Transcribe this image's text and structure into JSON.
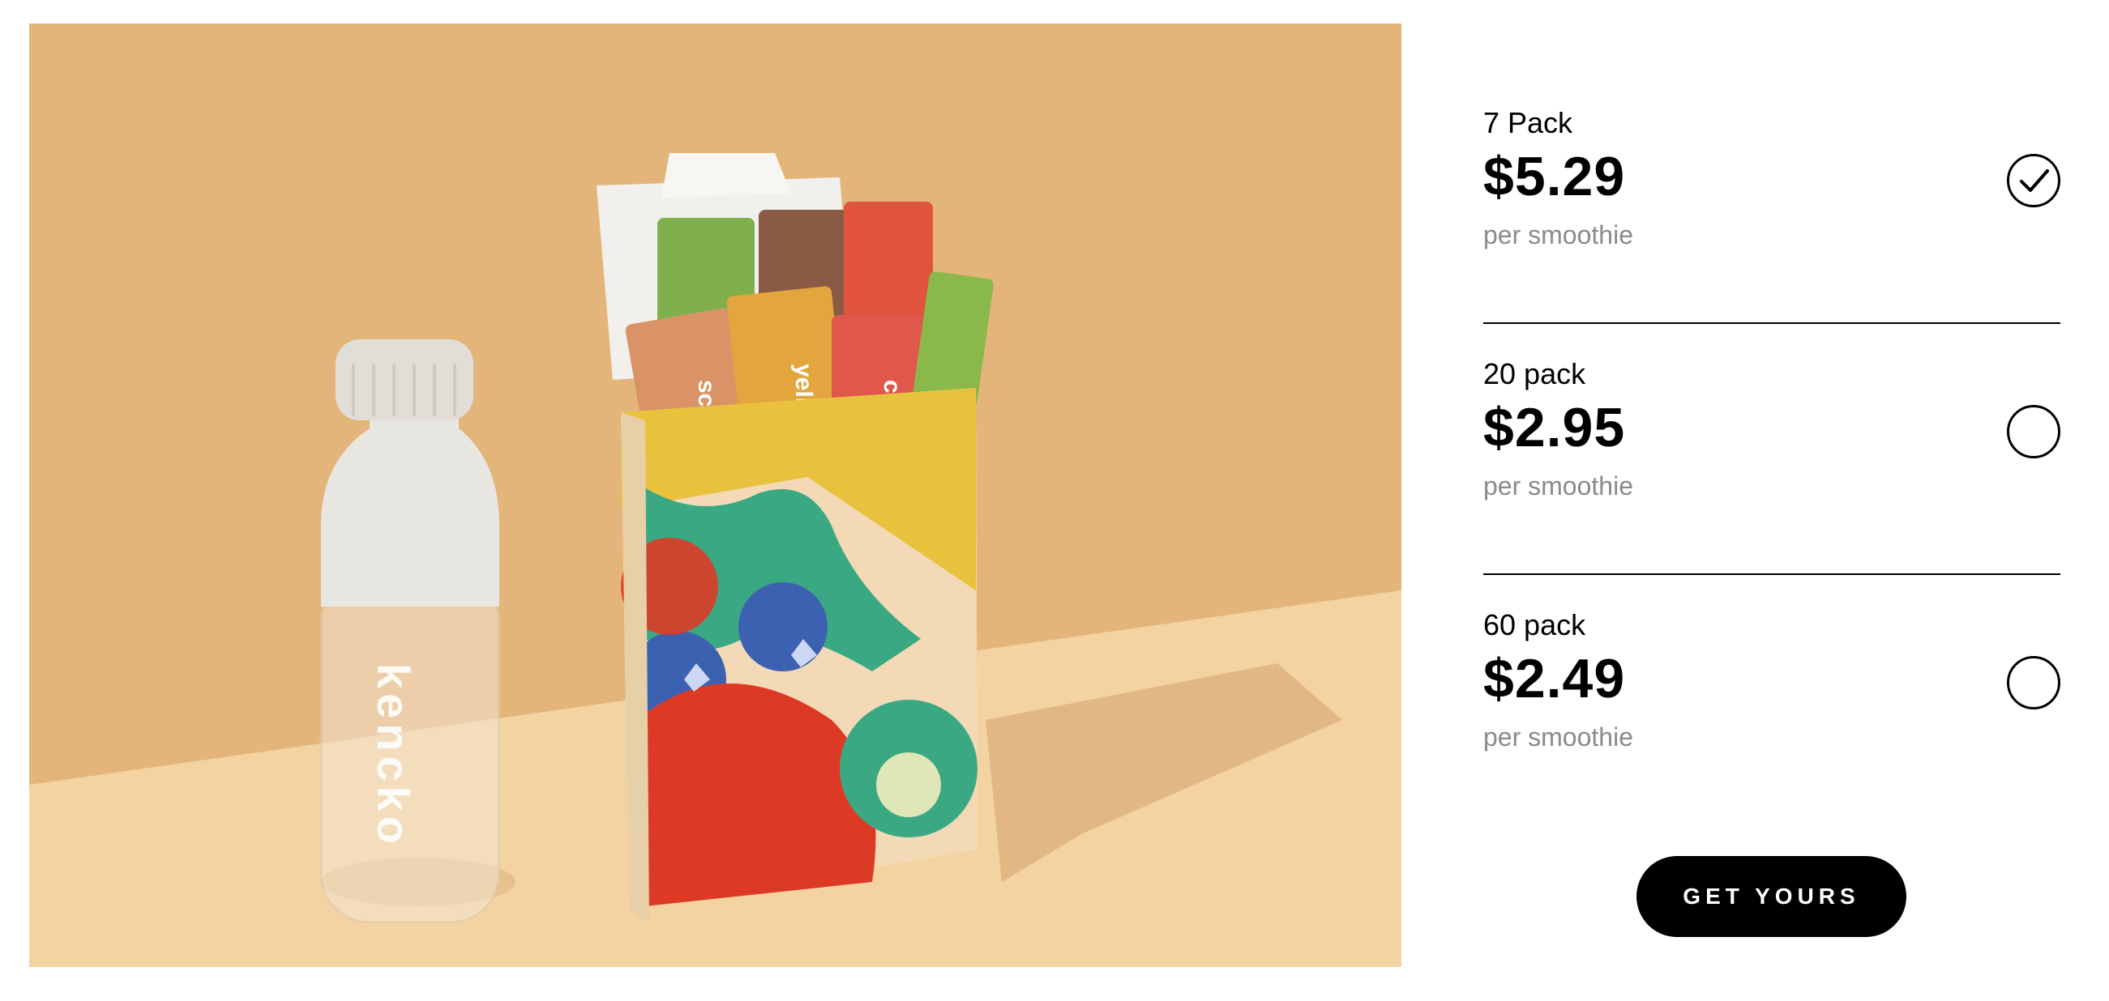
{
  "hero": {
    "bottle_brand": "kencko",
    "packet_labels": [
      "scarlets",
      "yellows",
      "corals"
    ]
  },
  "options": [
    {
      "name": "7 Pack",
      "price": "$5.29",
      "unit": "per smoothie",
      "selected": true
    },
    {
      "name": "20 pack",
      "price": "$2.95",
      "unit": "per smoothie",
      "selected": false
    },
    {
      "name": "60 pack",
      "price": "$2.49",
      "unit": "per smoothie",
      "selected": false
    }
  ],
  "cta": {
    "label": "GET YOURS"
  },
  "colors": {
    "background_wall": "#e4b57a",
    "background_table": "#f4d3a2",
    "button": "#000000",
    "muted_text": "#8a8a8a"
  }
}
